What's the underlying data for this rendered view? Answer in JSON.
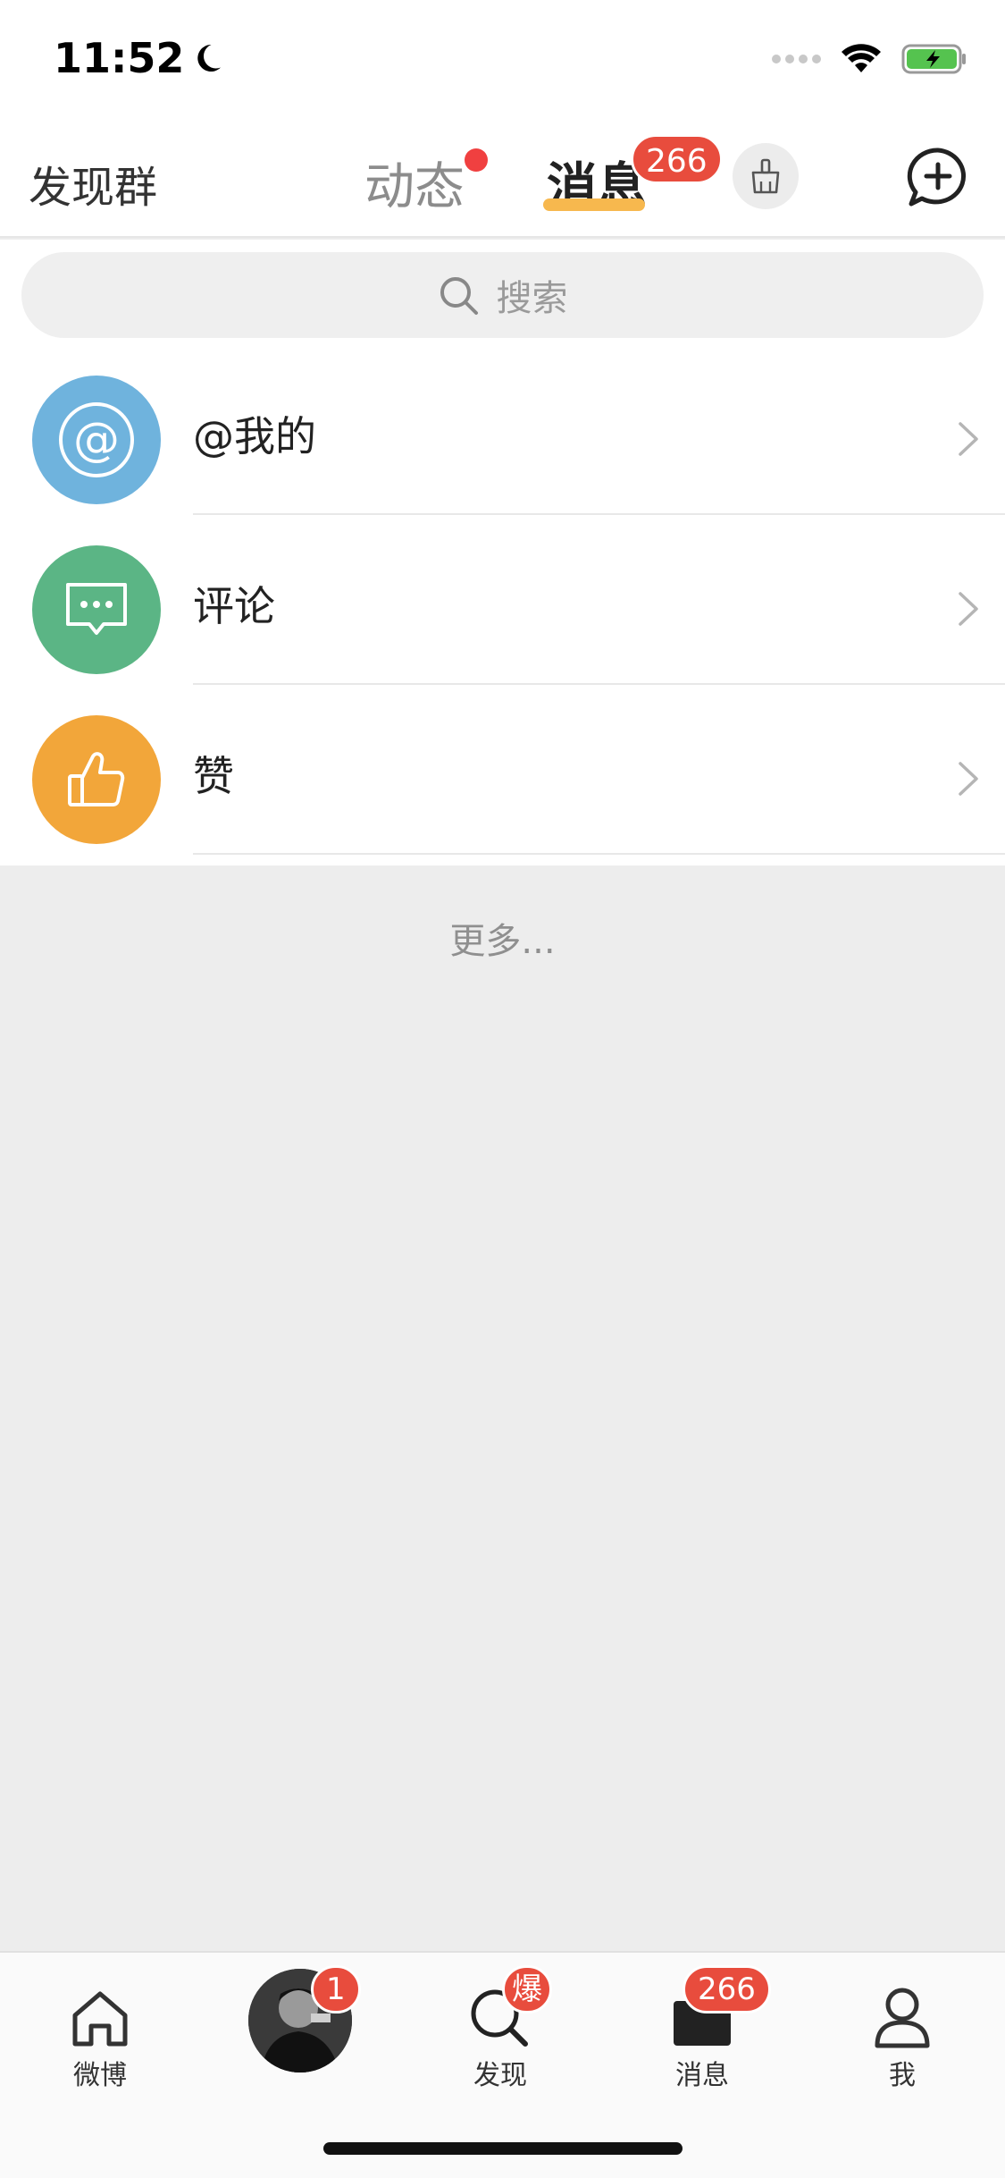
{
  "status_bar": {
    "time": "11:52",
    "battery_color": "#55c34f"
  },
  "top_nav": {
    "left_link": "发现群",
    "tabs": [
      {
        "label": "动态",
        "has_dot": true
      },
      {
        "label": "消息",
        "active": true,
        "badge": "266"
      }
    ],
    "accent_color": "#f7b84e",
    "badge_color": "#e84c3d"
  },
  "search": {
    "placeholder": "搜索"
  },
  "messages": [
    {
      "label": "@我的",
      "icon": "at-icon",
      "color": "#6fb3dd"
    },
    {
      "label": "评论",
      "icon": "comment-icon",
      "color": "#5bb585"
    },
    {
      "label": "赞",
      "icon": "thumbs-up-icon",
      "color": "#f2a63a"
    }
  ],
  "more": "更多...",
  "tab_bar": {
    "items": [
      {
        "label": "微博",
        "icon": "home-icon"
      },
      {
        "label": "",
        "icon": "avatar",
        "badge": "1"
      },
      {
        "label": "发现",
        "icon": "search-icon",
        "badge": "爆"
      },
      {
        "label": "消息",
        "icon": "mail-icon",
        "badge": "266"
      },
      {
        "label": "我",
        "icon": "user-icon"
      }
    ]
  }
}
